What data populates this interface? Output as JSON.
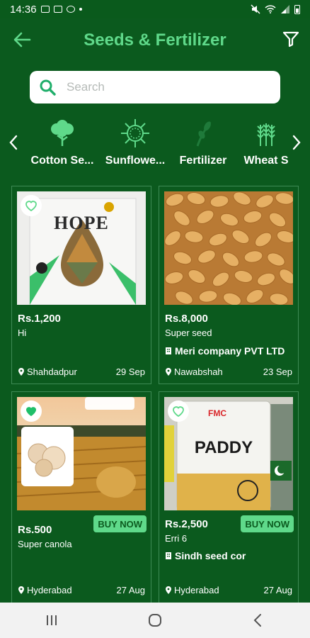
{
  "status_bar": {
    "time": "14:36"
  },
  "app_bar": {
    "title": "Seeds & Fertilizer"
  },
  "search": {
    "placeholder": "Search"
  },
  "categories": [
    {
      "label": "Cotton Se...",
      "icon": "cotton-icon"
    },
    {
      "label": "Sunflowe...",
      "icon": "sunflower-icon"
    },
    {
      "label": "Fertilizer",
      "icon": "fertilizer-icon"
    },
    {
      "label": "Wheat S",
      "icon": "wheat-icon"
    }
  ],
  "products": [
    {
      "price": "Rs.1,200",
      "name": "Hi",
      "company": "",
      "location": "Shahdadpur",
      "date": "29 Sep",
      "buy_label": "",
      "favorite": false,
      "image_text": "HOPE"
    },
    {
      "price": "Rs.8,000",
      "name": "Super seed",
      "company": "Meri company PVT LTD",
      "location": "Nawabshah",
      "date": "23 Sep",
      "buy_label": "",
      "favorite": false,
      "image_text": ""
    },
    {
      "price": "Rs.500",
      "name": "Super canola",
      "company": "",
      "location": "Hyderabad",
      "date": "27 Aug",
      "buy_label": "BUY NOW",
      "favorite": true,
      "image_text": ""
    },
    {
      "price": "Rs.2,500",
      "name": "Erri 6",
      "company": "Sindh seed cor",
      "location": "Hyderabad",
      "date": "27 Aug",
      "buy_label": "BUY NOW",
      "favorite": false,
      "image_text": "PADDY",
      "image_brand": "FMC"
    }
  ],
  "colors": {
    "background": "#0b5a1e",
    "accent": "#5fd98a",
    "card_border": "#3e8a55"
  }
}
